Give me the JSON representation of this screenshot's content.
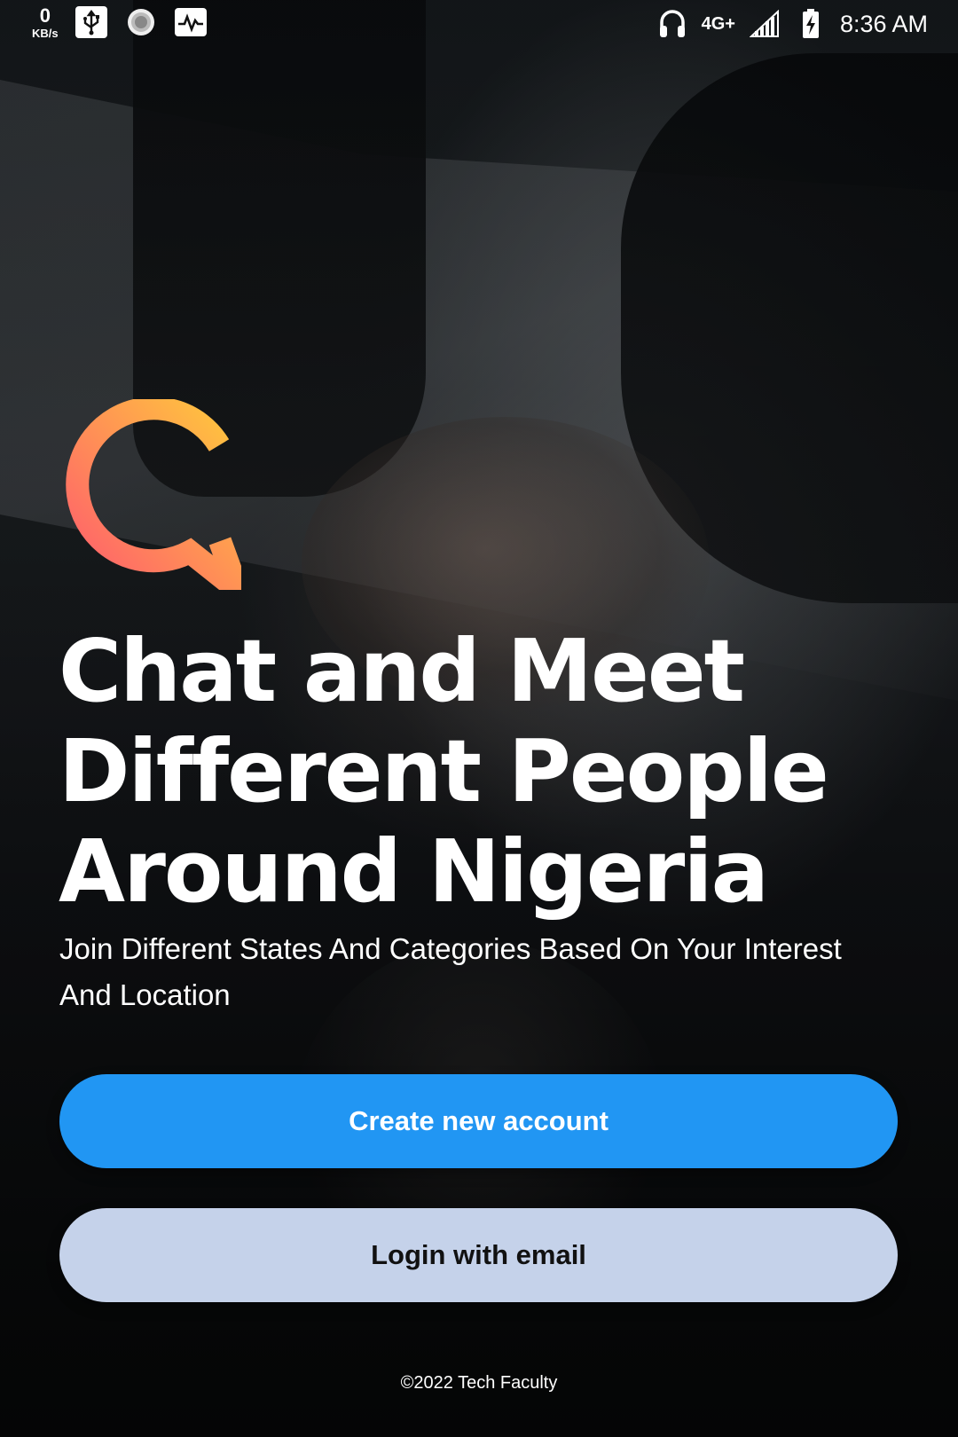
{
  "status_bar": {
    "net_speed_value": "0",
    "net_speed_unit": "KB/s",
    "network_type": "4G+",
    "time": "8:36 AM",
    "icons": [
      "usb-icon",
      "loading-icon",
      "activity-icon",
      "headphones-icon",
      "signal-icon",
      "battery-charging-icon"
    ]
  },
  "welcome": {
    "logo": "chat-bubble-logo",
    "headline_line1": "Chat and Meet",
    "headline_line2": "Different People",
    "headline_line3": "Around Nigeria",
    "subtitle_line1": "Join Different States And Categories Based On Your Interest",
    "subtitle_line2": "And Location"
  },
  "actions": {
    "create_account_label": "Create new account",
    "login_email_label": "Login with email"
  },
  "footer": {
    "copyright": "©2022 Tech Faculty"
  },
  "colors": {
    "primary": "#2196f3",
    "secondary": "#c5d2ea",
    "logo_gradient_start": "#ff5a6e",
    "logo_gradient_end": "#ffc93c"
  }
}
